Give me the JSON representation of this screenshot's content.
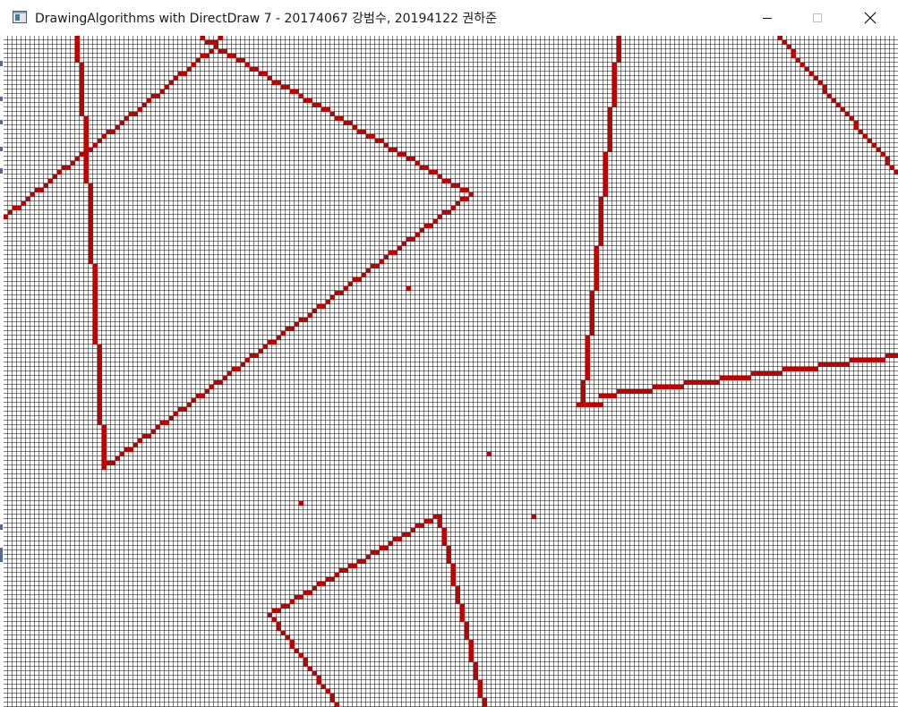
{
  "window": {
    "title": "DrawingAlgorithms with DirectDraw 7 - 20174067 강범수, 20194122 권하준",
    "icon": "app-window-icon",
    "controls": {
      "minimize_icon": "minimize-icon",
      "maximize_icon": "maximize-icon",
      "close_icon": "close-icon"
    }
  },
  "canvas": {
    "grid_line_color": "#000000",
    "background_color": "#ffffff",
    "pixel_color": "#c00000"
  }
}
